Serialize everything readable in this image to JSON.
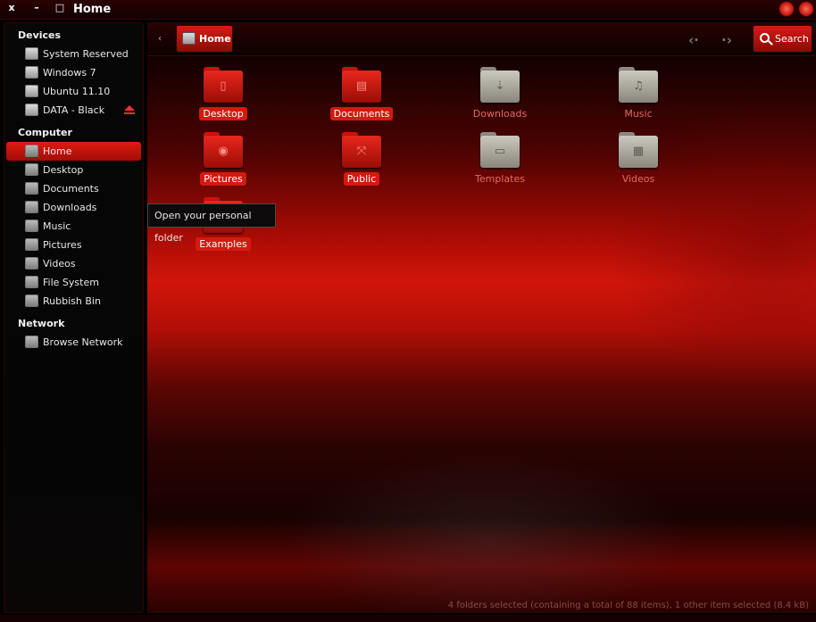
{
  "window": {
    "title": "Home",
    "close_glyph": "x",
    "minimize_glyph": "–",
    "maximize_glyph": "□"
  },
  "sidebar": {
    "sections": [
      {
        "title": "Devices",
        "items": [
          {
            "label": "System Reserved",
            "icon": "drive-icon"
          },
          {
            "label": "Windows 7",
            "icon": "drive-icon"
          },
          {
            "label": "Ubuntu 11.10",
            "icon": "drive-icon"
          },
          {
            "label": "DATA - Black",
            "icon": "drive-icon",
            "eject": true
          }
        ]
      },
      {
        "title": "Computer",
        "items": [
          {
            "label": "Home",
            "icon": "home-folder-icon",
            "active": true
          },
          {
            "label": "Desktop",
            "icon": "desktop-folder-icon"
          },
          {
            "label": "Documents",
            "icon": "documents-folder-icon"
          },
          {
            "label": "Downloads",
            "icon": "downloads-folder-icon"
          },
          {
            "label": "Music",
            "icon": "music-folder-icon"
          },
          {
            "label": "Pictures",
            "icon": "pictures-folder-icon"
          },
          {
            "label": "Videos",
            "icon": "videos-folder-icon"
          },
          {
            "label": "File System",
            "icon": "filesystem-icon"
          },
          {
            "label": "Rubbish Bin",
            "icon": "trash-icon"
          }
        ]
      },
      {
        "title": "Network",
        "items": [
          {
            "label": "Browse Network",
            "icon": "network-icon"
          }
        ]
      }
    ]
  },
  "toolbar": {
    "breadcrumb": "Home",
    "back_glyph": "‹",
    "back_nav_glyph": "‹·",
    "forward_nav_glyph": "·›",
    "search_label": "Search"
  },
  "files": [
    {
      "name": "Desktop",
      "selected": true,
      "color": "red",
      "emblem": "▯"
    },
    {
      "name": "Documents",
      "selected": true,
      "color": "red",
      "emblem": "▤"
    },
    {
      "name": "Downloads",
      "selected": false,
      "color": "grey",
      "emblem": "⇣"
    },
    {
      "name": "Music",
      "selected": false,
      "color": "grey",
      "emblem": "♫"
    },
    {
      "name": "Pictures",
      "selected": true,
      "color": "red",
      "emblem": "◉"
    },
    {
      "name": "Public",
      "selected": true,
      "color": "red",
      "emblem": "⤧"
    },
    {
      "name": "Templates",
      "selected": false,
      "color": "grey",
      "emblem": "▭"
    },
    {
      "name": "Videos",
      "selected": false,
      "color": "grey",
      "emblem": "▦"
    },
    {
      "name": "Examples",
      "selected": true,
      "color": "red",
      "emblem": ""
    }
  ],
  "tooltip": "Open your personal folder",
  "status": "4 folders selected (containing a total of 88 items), 1 other item selected (8.4 kB)",
  "colors": {
    "accent": "#d41a10",
    "unselected_label": "#e56a5f",
    "background": "#000000"
  }
}
